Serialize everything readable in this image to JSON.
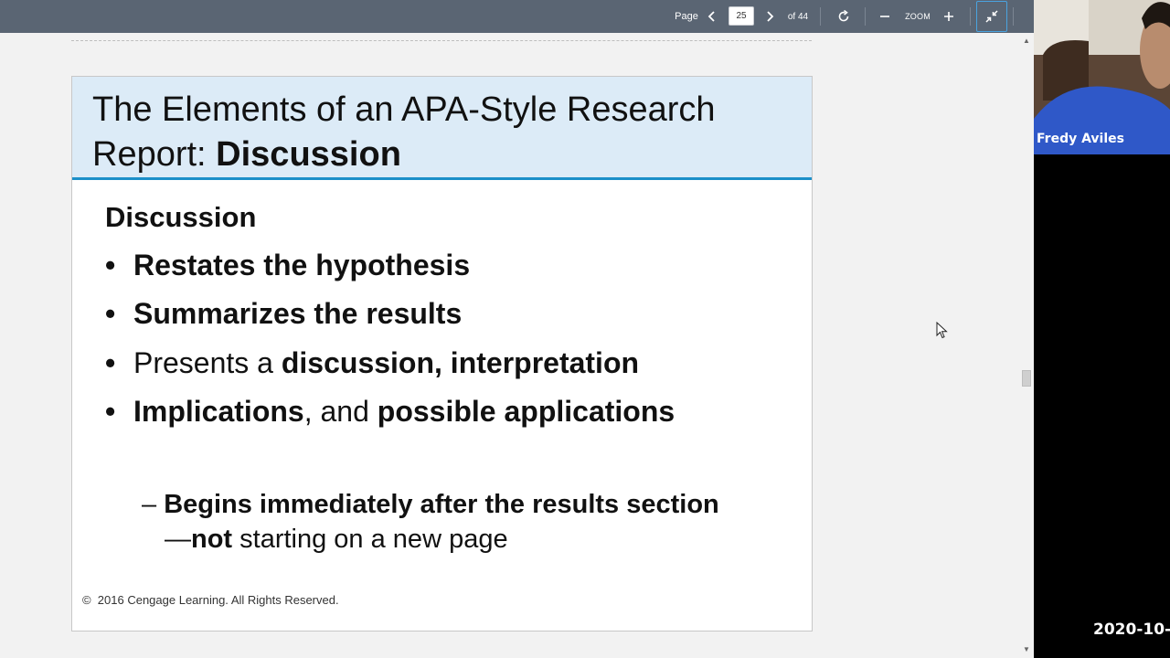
{
  "toolbar": {
    "page_label": "Page",
    "page_value": "25",
    "page_total": "of 44",
    "zoom_label": "ZOOM",
    "icons": {
      "prev": "chevron-left-icon",
      "next": "chevron-right-icon",
      "rotate": "rotate-icon",
      "zoom_out": "minus-icon",
      "zoom_in": "plus-icon",
      "fit": "collapse-icon"
    }
  },
  "slide": {
    "title_line1": "The Elements of an APA-Style Research",
    "title_line2_prefix": "Report: ",
    "title_line2_bold": "Discussion",
    "heading": "Discussion",
    "bullets": [
      {
        "parts": [
          {
            "text": "Restates the hypothesis",
            "bold": true
          }
        ]
      },
      {
        "parts": [
          {
            "text": "Summarizes the results",
            "bold": true
          }
        ]
      },
      {
        "parts": [
          {
            "text": "Presents a ",
            "bold": false
          },
          {
            "text": "discussion, interpretation",
            "bold": true
          }
        ]
      },
      {
        "parts": [
          {
            "text": "Implications",
            "bold": true
          },
          {
            "text": ", and ",
            "bold": false
          },
          {
            "text": "possible applications",
            "bold": true
          }
        ]
      }
    ],
    "sub_line1_dash": "– ",
    "sub_line1": "Begins immediately after the results section",
    "sub_line2_dash": "—",
    "sub_line2_bold": "not",
    "sub_line2_rest": " starting on a new page",
    "footer": "©  2016 Cengage Learning. All Rights Reserved.",
    "header_color": "#dcebf7",
    "accent_color": "#1b8fc9"
  },
  "participant": {
    "name": "Fredy Aviles"
  },
  "overlay": {
    "timestamp": "2020-10-"
  }
}
